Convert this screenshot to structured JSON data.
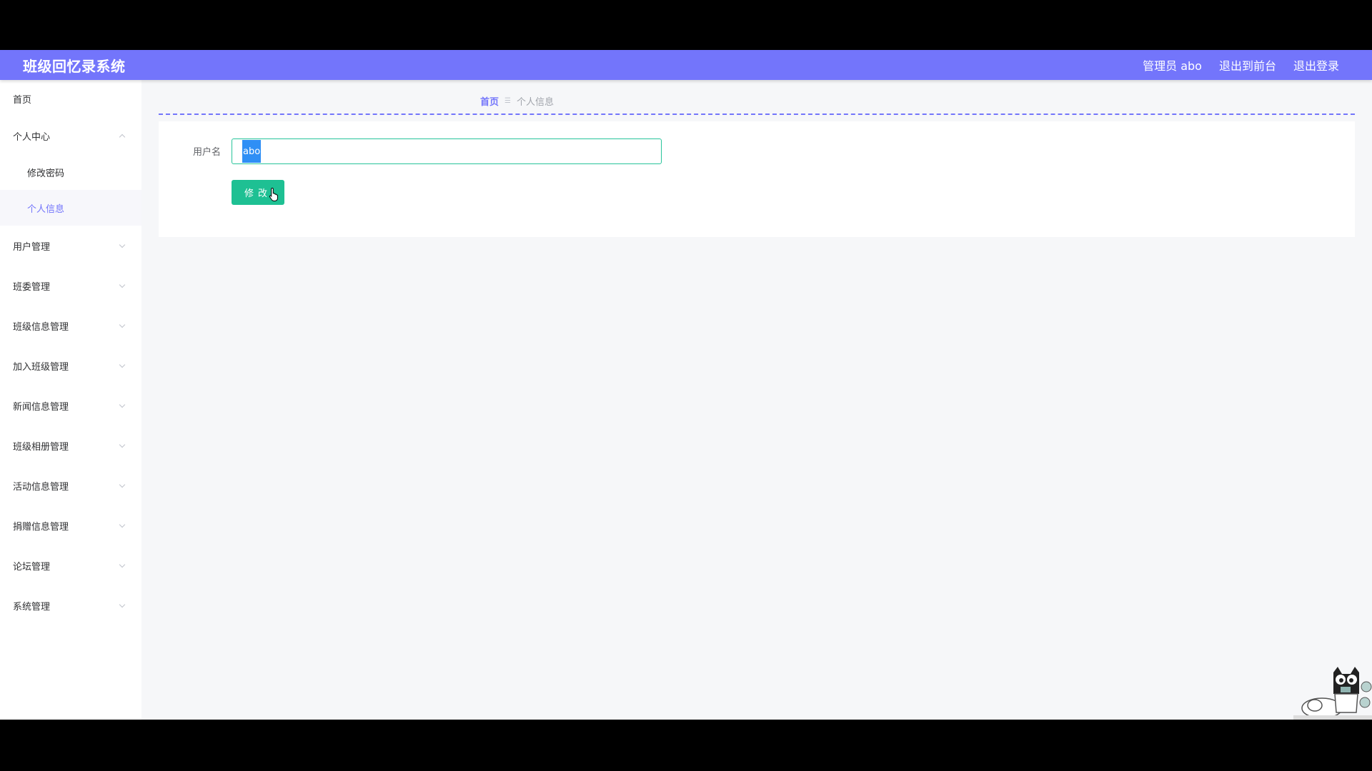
{
  "header": {
    "title": "班级回忆录系统",
    "user_label": "管理员 abo",
    "front_label": "退出到前台",
    "logout_label": "退出登录"
  },
  "sidebar": {
    "items": [
      {
        "label": "首页"
      },
      {
        "label": "个人中心",
        "expanded": true,
        "children": [
          {
            "label": "修改密码"
          },
          {
            "label": "个人信息",
            "active": true
          }
        ]
      },
      {
        "label": "用户管理"
      },
      {
        "label": "班委管理"
      },
      {
        "label": "班级信息管理"
      },
      {
        "label": "加入班级管理"
      },
      {
        "label": "新闻信息管理"
      },
      {
        "label": "班级相册管理"
      },
      {
        "label": "活动信息管理"
      },
      {
        "label": "捐赠信息管理"
      },
      {
        "label": "论坛管理"
      },
      {
        "label": "系统管理"
      }
    ]
  },
  "breadcrumb": {
    "home": "首页",
    "separator": "☰",
    "current": "个人信息"
  },
  "form": {
    "username_label": "用户名",
    "username_value": "abo",
    "submit_label": "修改"
  },
  "colors": {
    "primary": "#7375fb",
    "button": "#1ec093",
    "input_border": "#27c49a",
    "selection": "#2f8ff5"
  }
}
